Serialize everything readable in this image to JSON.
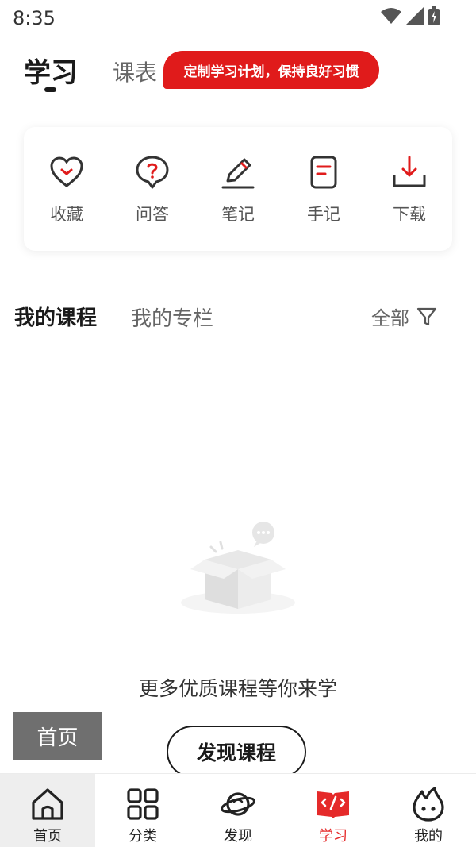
{
  "status": {
    "time": "8:35"
  },
  "header": {
    "tab_learn": "学习",
    "tab_schedule": "课表",
    "plan_banner": "定制学习计划，保持良好习惯"
  },
  "quick_actions": [
    {
      "label": "收藏",
      "icon": "heart-icon"
    },
    {
      "label": "问答",
      "icon": "question-bubble-icon"
    },
    {
      "label": "笔记",
      "icon": "pencil-icon"
    },
    {
      "label": "手记",
      "icon": "document-icon"
    },
    {
      "label": "下载",
      "icon": "download-icon"
    }
  ],
  "course_tabs": {
    "mine": "我的课程",
    "column": "我的专栏",
    "filter_label": "全部"
  },
  "empty_state": {
    "text": "更多优质课程等你来学",
    "button": "发现课程"
  },
  "home_float": "首页",
  "bottom_nav": [
    {
      "label": "首页",
      "icon": "home-icon"
    },
    {
      "label": "分类",
      "icon": "grid-icon"
    },
    {
      "label": "发现",
      "icon": "planet-icon"
    },
    {
      "label": "学习",
      "icon": "code-book-icon"
    },
    {
      "label": "我的",
      "icon": "flame-face-icon"
    }
  ],
  "colors": {
    "accent": "#e01b1b",
    "active_nav": "#e52a2a"
  }
}
